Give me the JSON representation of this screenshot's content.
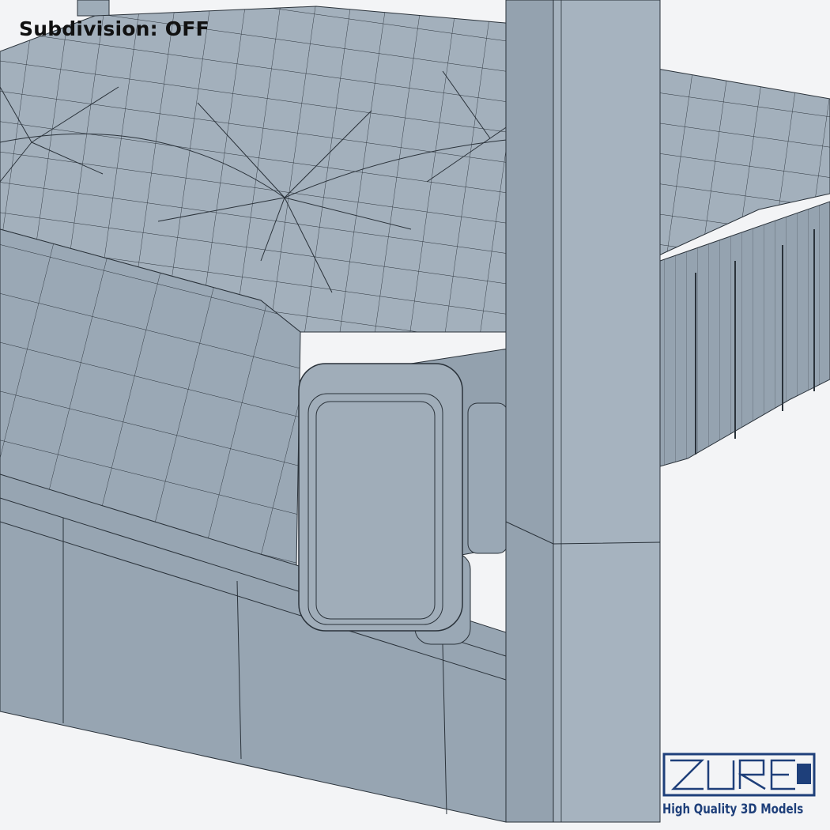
{
  "overlay": {
    "subdivision_label": "Subdivision: OFF"
  },
  "watermark": {
    "logo_text": "ZUREL",
    "tagline": "High Quality 3D Models",
    "brand_color": "#1e3f7a"
  },
  "colors": {
    "background": "#f3f4f6",
    "mesh_fill": "#9eacb8",
    "mesh_shade": "#8e9caa",
    "wire": "#2a323a"
  }
}
